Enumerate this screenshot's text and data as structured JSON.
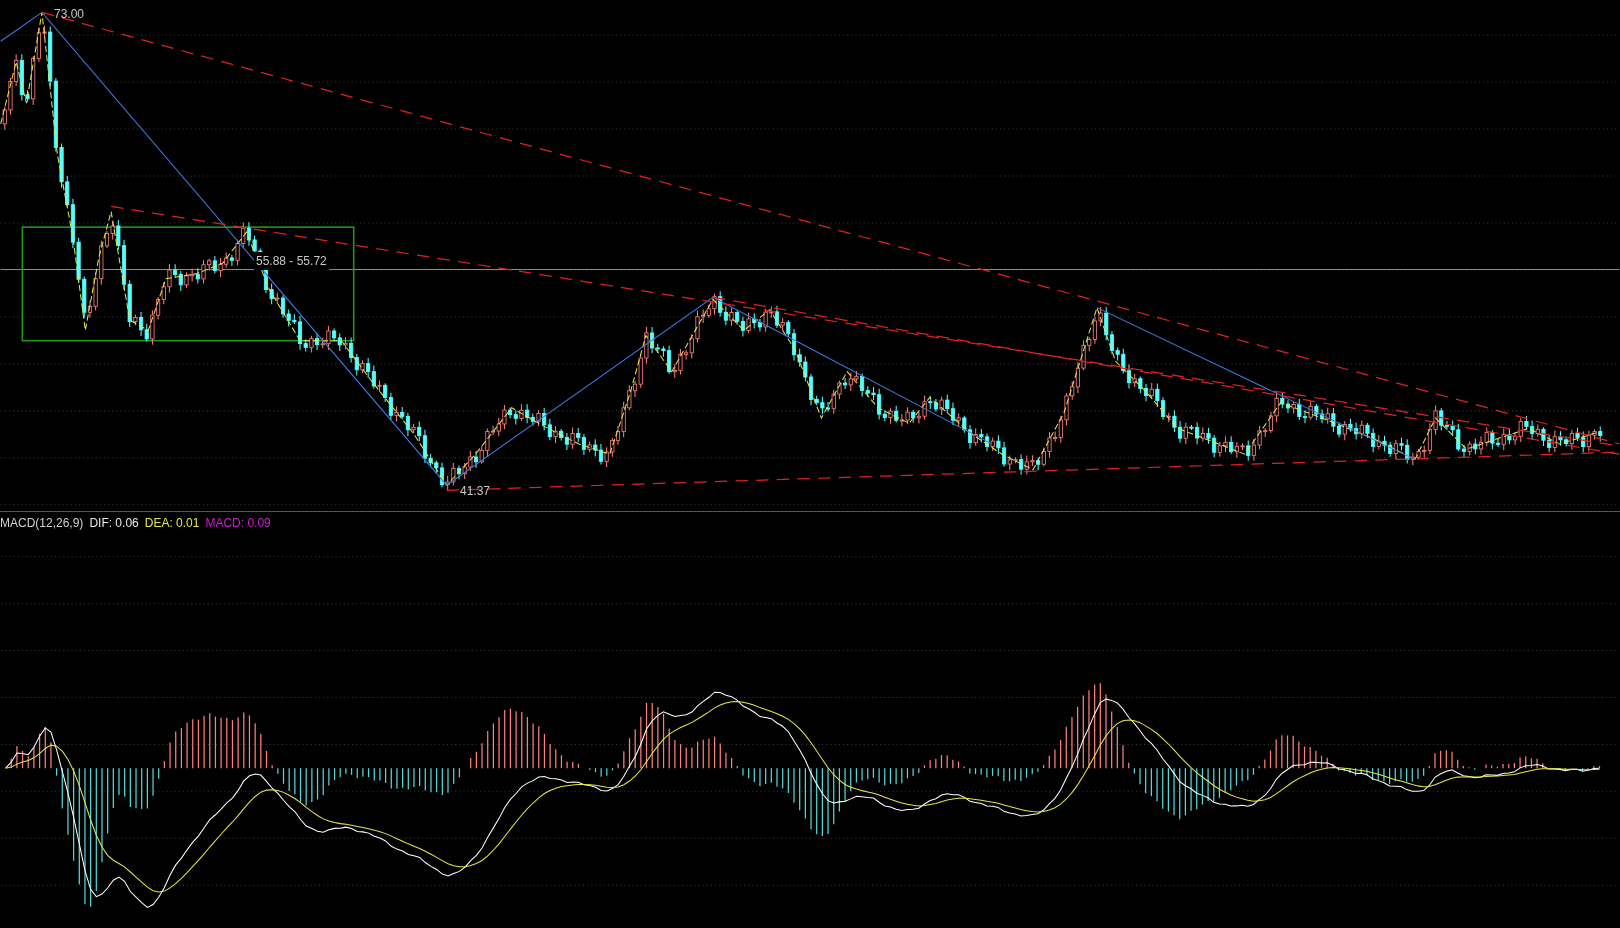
{
  "price_chart": {
    "high_label": "73.00",
    "low_label": "41.37",
    "range_label": "55.88 - 55.72"
  },
  "macd_legend": {
    "title": "MACD(12,26,9)",
    "dif": "DIF: 0.06",
    "dea": "DEA: 0.01",
    "macd": "MACD: 0.09"
  }
}
